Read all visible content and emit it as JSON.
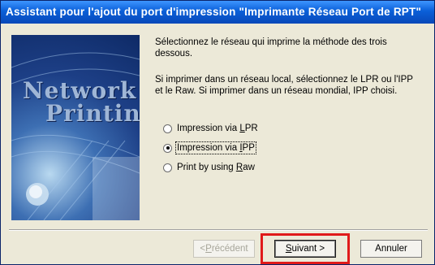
{
  "window": {
    "title": "Assistant pour l'ajout du port d'impression \"Imprimante Réseau Port de RPT\""
  },
  "banner": {
    "line1": "Network",
    "line2": "Printing"
  },
  "content": {
    "description1": "Sélectionnez le réseau qui imprime la méthode des trois dessous.",
    "description2": "Si imprimer dans un réseau local, sélectionnez le LPR ou l'IPP et le Raw.  Si imprimer dans un réseau mondial, IPP choisi."
  },
  "options": [
    {
      "pre": "Impression via ",
      "key": "L",
      "post": "PR",
      "checked": false
    },
    {
      "pre": "Impression via ",
      "key": "I",
      "post": "PP",
      "checked": true
    },
    {
      "pre": "Print by using ",
      "key": "R",
      "post": "aw",
      "checked": false
    }
  ],
  "buttons": {
    "back": {
      "pre": "< ",
      "key": "P",
      "post": "récédent",
      "enabled": false
    },
    "next": {
      "pre": "",
      "key": "S",
      "post": "uivant >",
      "enabled": true
    },
    "cancel": {
      "label": "Annuler"
    }
  },
  "colors": {
    "title_bar": "#0a5fd8",
    "highlight": "#e01a1a"
  }
}
